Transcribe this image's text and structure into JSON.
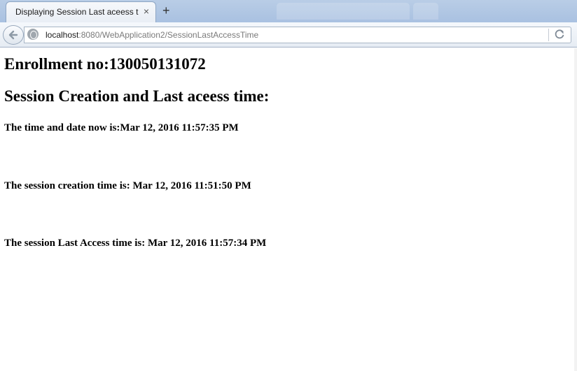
{
  "browser": {
    "tab_title": "Displaying Session Last aceess t...",
    "tab_close_glyph": "×",
    "new_tab_glyph": "+",
    "url_host": "localhost",
    "url_rest": ":8080/WebApplication2/SessionLastAccessTime",
    "icons": [
      "back-arrow-icon",
      "globe-icon",
      "reload-icon",
      "close-icon",
      "plus-icon"
    ]
  },
  "page": {
    "enrollment": "Enrollment no:130050131072",
    "subtitle": "Session Creation and Last aceess time:",
    "now_line": "The time and date now is:Mar 12, 2016 11:57:35 PM",
    "creation_line": "The session creation time is: Mar 12, 2016 11:51:50 PM",
    "last_access_line": "The session Last Access time is: Mar 12, 2016 11:57:34 PM"
  },
  "colors": {
    "tabbar": "#b9cde6",
    "text": "#000000",
    "url_host": "#1a1a1a",
    "url_path": "#7a7a7a"
  }
}
